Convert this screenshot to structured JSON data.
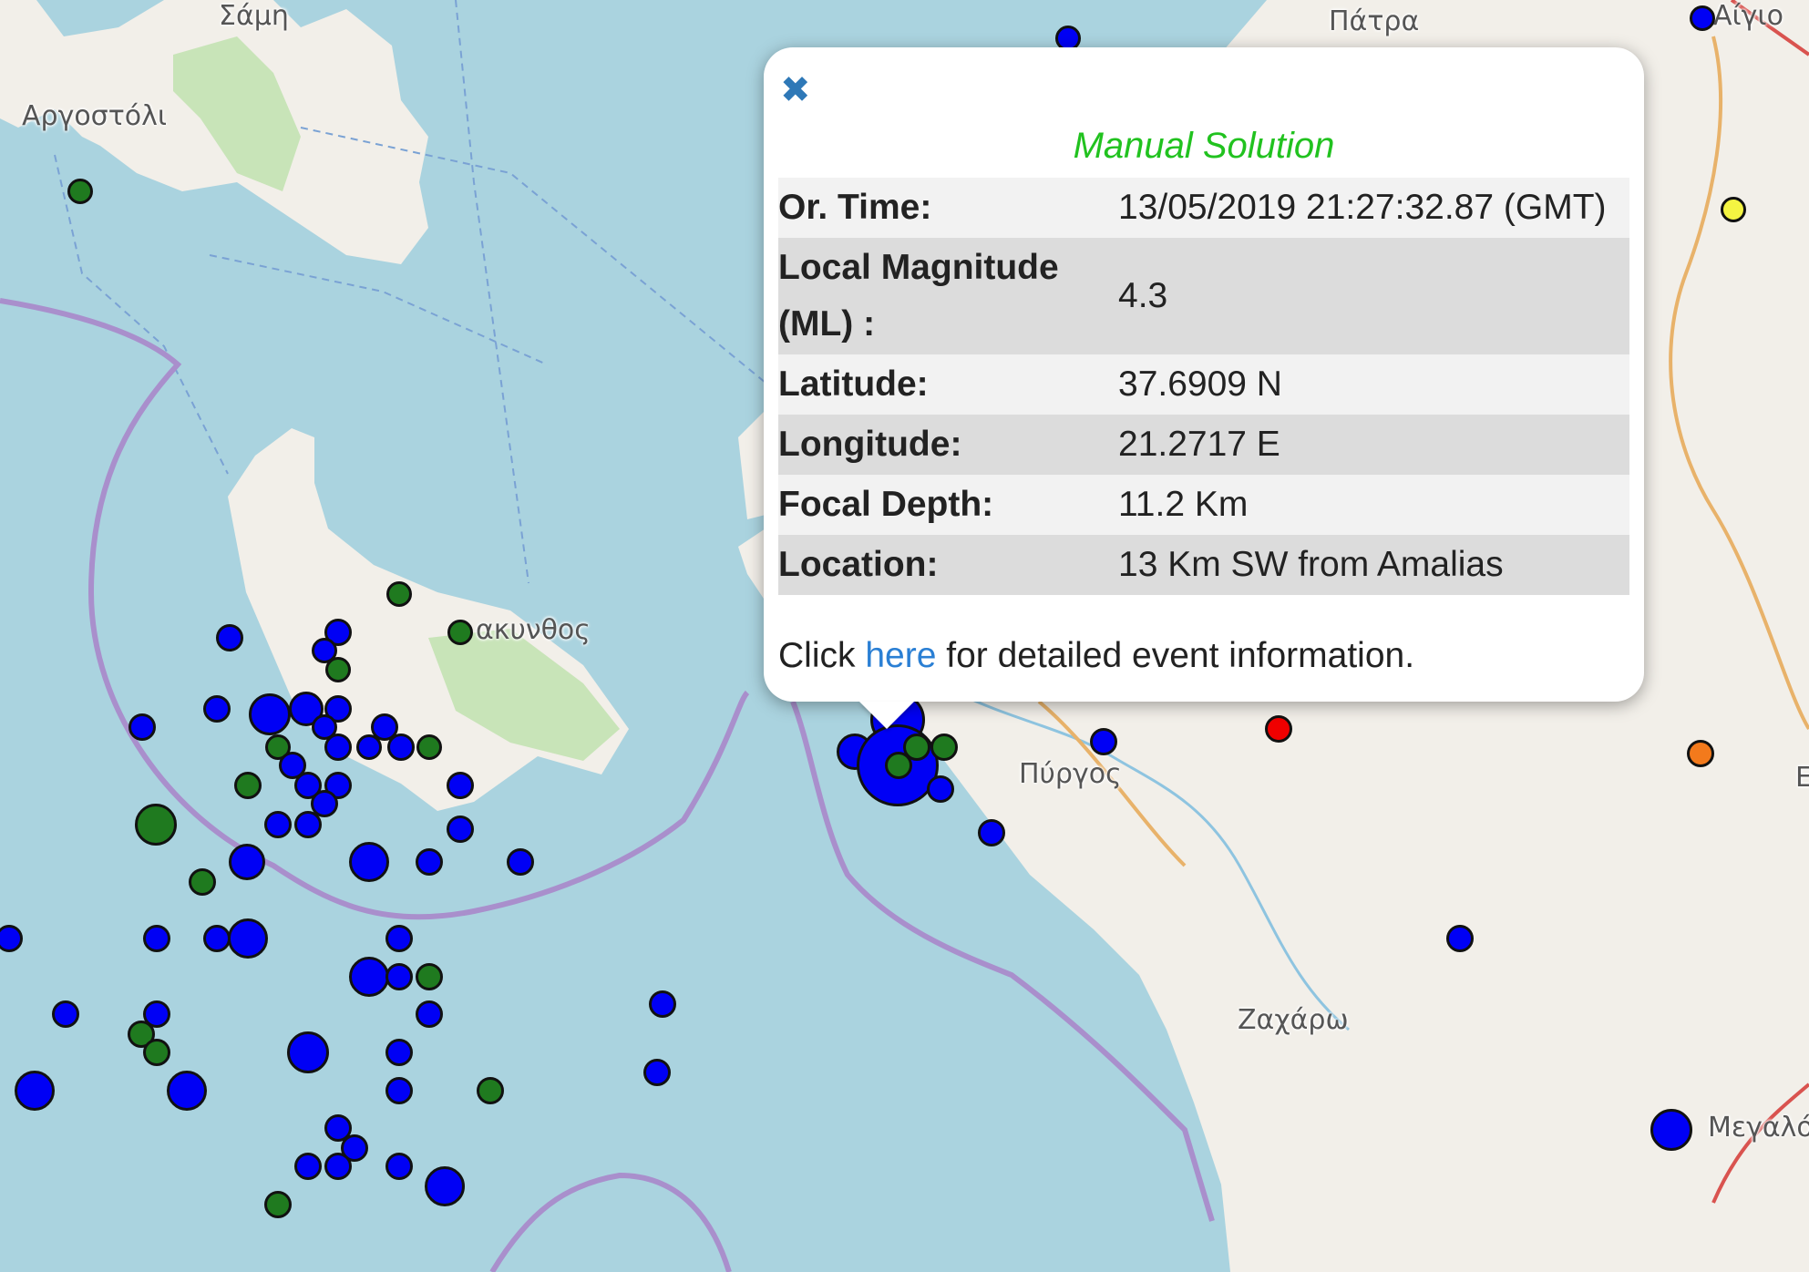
{
  "map": {
    "places": [
      {
        "name": "Σάμη"
      },
      {
        "name": "Αργοστόλι"
      },
      {
        "name": "Πάτρα"
      },
      {
        "name": "Αίγιο"
      },
      {
        "name": "ακυνθος"
      },
      {
        "name": "Πύργος"
      },
      {
        "name": "Ζαχάρω"
      },
      {
        "name": "Μεγαλό"
      },
      {
        "name": "Ε"
      }
    ],
    "colors": {
      "sea": "#aad3df",
      "land": "#f2efe9",
      "forest": "#c8e4b8",
      "border": "#a98fcc",
      "river": "#8ec4e0",
      "road": "#e8b26a",
      "quake_blue": "#0000f5",
      "quake_green": "#1f7a1f",
      "quake_yellow": "#f4f442",
      "quake_red": "#f00000",
      "quake_orange": "#f37a1c"
    }
  },
  "popup": {
    "close_icon": "close-icon",
    "title": "Manual Solution",
    "title_color": "#21c21f",
    "rows": [
      {
        "key": "Or. Time:",
        "value": "13/05/2019 21:27:32.87 (GMT)"
      },
      {
        "key": "Local Magnitude (ML) :",
        "value": "4.3"
      },
      {
        "key": "Latitude:",
        "value": "37.6909 N"
      },
      {
        "key": "Longitude:",
        "value": "21.2717 E"
      },
      {
        "key": "Focal Depth:",
        "value": "11.2 Km"
      },
      {
        "key": "Location:",
        "value": "13 Km SW from Amalias"
      }
    ],
    "more_prefix": "Click",
    "more_link": "here",
    "more_suffix": "for detailed event information."
  }
}
